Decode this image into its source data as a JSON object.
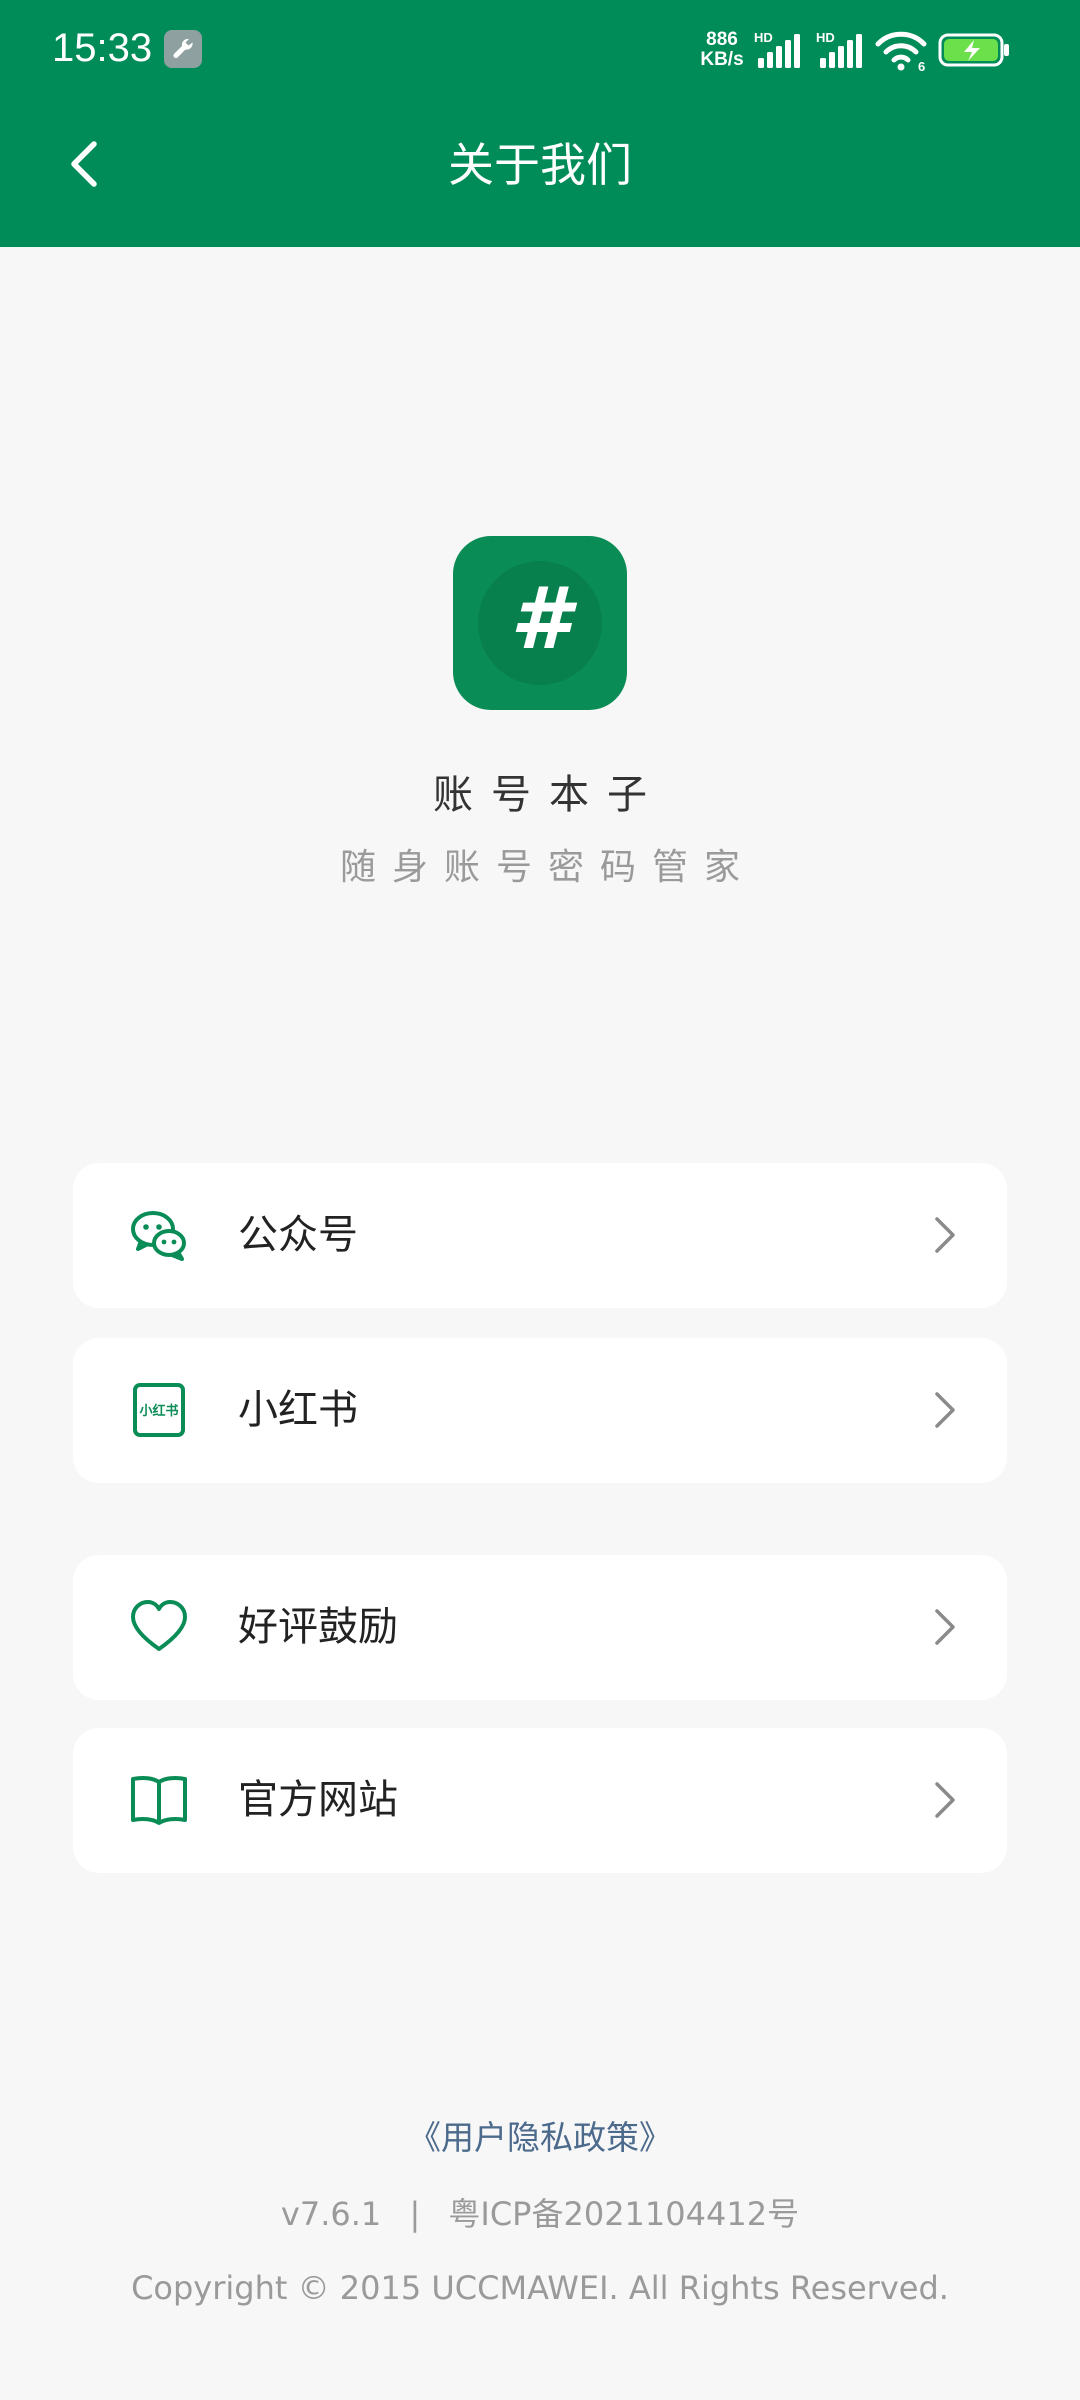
{
  "status_bar": {
    "time": "15:33",
    "speed_value": "886",
    "speed_unit": "KB/s",
    "signal_label_1": "HD",
    "signal_label_2": "HD",
    "wifi_badge": "6",
    "icons": [
      "wrench-icon",
      "signal-icon",
      "signal-icon",
      "wifi-icon",
      "battery-charging-icon"
    ]
  },
  "header": {
    "title": "关于我们",
    "back_icon": "chevron-left-icon"
  },
  "app": {
    "logo_symbol": "#",
    "name": "账号本子",
    "slogan": "随身账号密码管家"
  },
  "menu": {
    "items": [
      {
        "label": "公众号",
        "icon": "wechat-icon"
      },
      {
        "label": "小红书",
        "icon": "xiaohongshu-icon",
        "icon_text": "小红书"
      },
      {
        "label": "好评鼓励",
        "icon": "heart-icon"
      },
      {
        "label": "官方网站",
        "icon": "book-icon"
      }
    ]
  },
  "footer": {
    "privacy_link": "《用户隐私政策》",
    "version": "v7.6.1",
    "separator": "|",
    "icp": "粤ICP备2021104412号",
    "copyright": "Copyright © 2015 UCCMAWEI. All Rights Reserved."
  },
  "colors": {
    "brand_green": "#008c58",
    "background": "#f7f7f7",
    "card": "#ffffff",
    "link": "#4c6a8c",
    "muted_text": "#9a9a9a"
  }
}
